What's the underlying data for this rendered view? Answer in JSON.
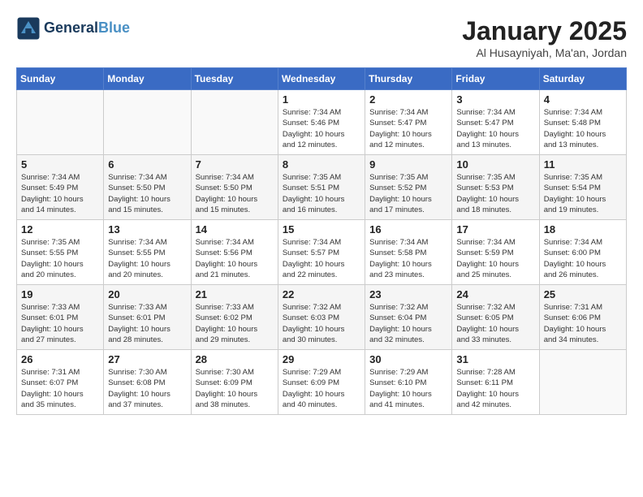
{
  "header": {
    "logo_line1": "General",
    "logo_line2": "Blue",
    "month_title": "January 2025",
    "location": "Al Husayniyah, Ma'an, Jordan"
  },
  "weekdays": [
    "Sunday",
    "Monday",
    "Tuesday",
    "Wednesday",
    "Thursday",
    "Friday",
    "Saturday"
  ],
  "weeks": [
    [
      {
        "day": "",
        "info": ""
      },
      {
        "day": "",
        "info": ""
      },
      {
        "day": "",
        "info": ""
      },
      {
        "day": "1",
        "info": "Sunrise: 7:34 AM\nSunset: 5:46 PM\nDaylight: 10 hours\nand 12 minutes."
      },
      {
        "day": "2",
        "info": "Sunrise: 7:34 AM\nSunset: 5:47 PM\nDaylight: 10 hours\nand 12 minutes."
      },
      {
        "day": "3",
        "info": "Sunrise: 7:34 AM\nSunset: 5:47 PM\nDaylight: 10 hours\nand 13 minutes."
      },
      {
        "day": "4",
        "info": "Sunrise: 7:34 AM\nSunset: 5:48 PM\nDaylight: 10 hours\nand 13 minutes."
      }
    ],
    [
      {
        "day": "5",
        "info": "Sunrise: 7:34 AM\nSunset: 5:49 PM\nDaylight: 10 hours\nand 14 minutes."
      },
      {
        "day": "6",
        "info": "Sunrise: 7:34 AM\nSunset: 5:50 PM\nDaylight: 10 hours\nand 15 minutes."
      },
      {
        "day": "7",
        "info": "Sunrise: 7:34 AM\nSunset: 5:50 PM\nDaylight: 10 hours\nand 15 minutes."
      },
      {
        "day": "8",
        "info": "Sunrise: 7:35 AM\nSunset: 5:51 PM\nDaylight: 10 hours\nand 16 minutes."
      },
      {
        "day": "9",
        "info": "Sunrise: 7:35 AM\nSunset: 5:52 PM\nDaylight: 10 hours\nand 17 minutes."
      },
      {
        "day": "10",
        "info": "Sunrise: 7:35 AM\nSunset: 5:53 PM\nDaylight: 10 hours\nand 18 minutes."
      },
      {
        "day": "11",
        "info": "Sunrise: 7:35 AM\nSunset: 5:54 PM\nDaylight: 10 hours\nand 19 minutes."
      }
    ],
    [
      {
        "day": "12",
        "info": "Sunrise: 7:35 AM\nSunset: 5:55 PM\nDaylight: 10 hours\nand 20 minutes."
      },
      {
        "day": "13",
        "info": "Sunrise: 7:34 AM\nSunset: 5:55 PM\nDaylight: 10 hours\nand 20 minutes."
      },
      {
        "day": "14",
        "info": "Sunrise: 7:34 AM\nSunset: 5:56 PM\nDaylight: 10 hours\nand 21 minutes."
      },
      {
        "day": "15",
        "info": "Sunrise: 7:34 AM\nSunset: 5:57 PM\nDaylight: 10 hours\nand 22 minutes."
      },
      {
        "day": "16",
        "info": "Sunrise: 7:34 AM\nSunset: 5:58 PM\nDaylight: 10 hours\nand 23 minutes."
      },
      {
        "day": "17",
        "info": "Sunrise: 7:34 AM\nSunset: 5:59 PM\nDaylight: 10 hours\nand 25 minutes."
      },
      {
        "day": "18",
        "info": "Sunrise: 7:34 AM\nSunset: 6:00 PM\nDaylight: 10 hours\nand 26 minutes."
      }
    ],
    [
      {
        "day": "19",
        "info": "Sunrise: 7:33 AM\nSunset: 6:01 PM\nDaylight: 10 hours\nand 27 minutes."
      },
      {
        "day": "20",
        "info": "Sunrise: 7:33 AM\nSunset: 6:01 PM\nDaylight: 10 hours\nand 28 minutes."
      },
      {
        "day": "21",
        "info": "Sunrise: 7:33 AM\nSunset: 6:02 PM\nDaylight: 10 hours\nand 29 minutes."
      },
      {
        "day": "22",
        "info": "Sunrise: 7:32 AM\nSunset: 6:03 PM\nDaylight: 10 hours\nand 30 minutes."
      },
      {
        "day": "23",
        "info": "Sunrise: 7:32 AM\nSunset: 6:04 PM\nDaylight: 10 hours\nand 32 minutes."
      },
      {
        "day": "24",
        "info": "Sunrise: 7:32 AM\nSunset: 6:05 PM\nDaylight: 10 hours\nand 33 minutes."
      },
      {
        "day": "25",
        "info": "Sunrise: 7:31 AM\nSunset: 6:06 PM\nDaylight: 10 hours\nand 34 minutes."
      }
    ],
    [
      {
        "day": "26",
        "info": "Sunrise: 7:31 AM\nSunset: 6:07 PM\nDaylight: 10 hours\nand 35 minutes."
      },
      {
        "day": "27",
        "info": "Sunrise: 7:30 AM\nSunset: 6:08 PM\nDaylight: 10 hours\nand 37 minutes."
      },
      {
        "day": "28",
        "info": "Sunrise: 7:30 AM\nSunset: 6:09 PM\nDaylight: 10 hours\nand 38 minutes."
      },
      {
        "day": "29",
        "info": "Sunrise: 7:29 AM\nSunset: 6:09 PM\nDaylight: 10 hours\nand 40 minutes."
      },
      {
        "day": "30",
        "info": "Sunrise: 7:29 AM\nSunset: 6:10 PM\nDaylight: 10 hours\nand 41 minutes."
      },
      {
        "day": "31",
        "info": "Sunrise: 7:28 AM\nSunset: 6:11 PM\nDaylight: 10 hours\nand 42 minutes."
      },
      {
        "day": "",
        "info": ""
      }
    ]
  ]
}
